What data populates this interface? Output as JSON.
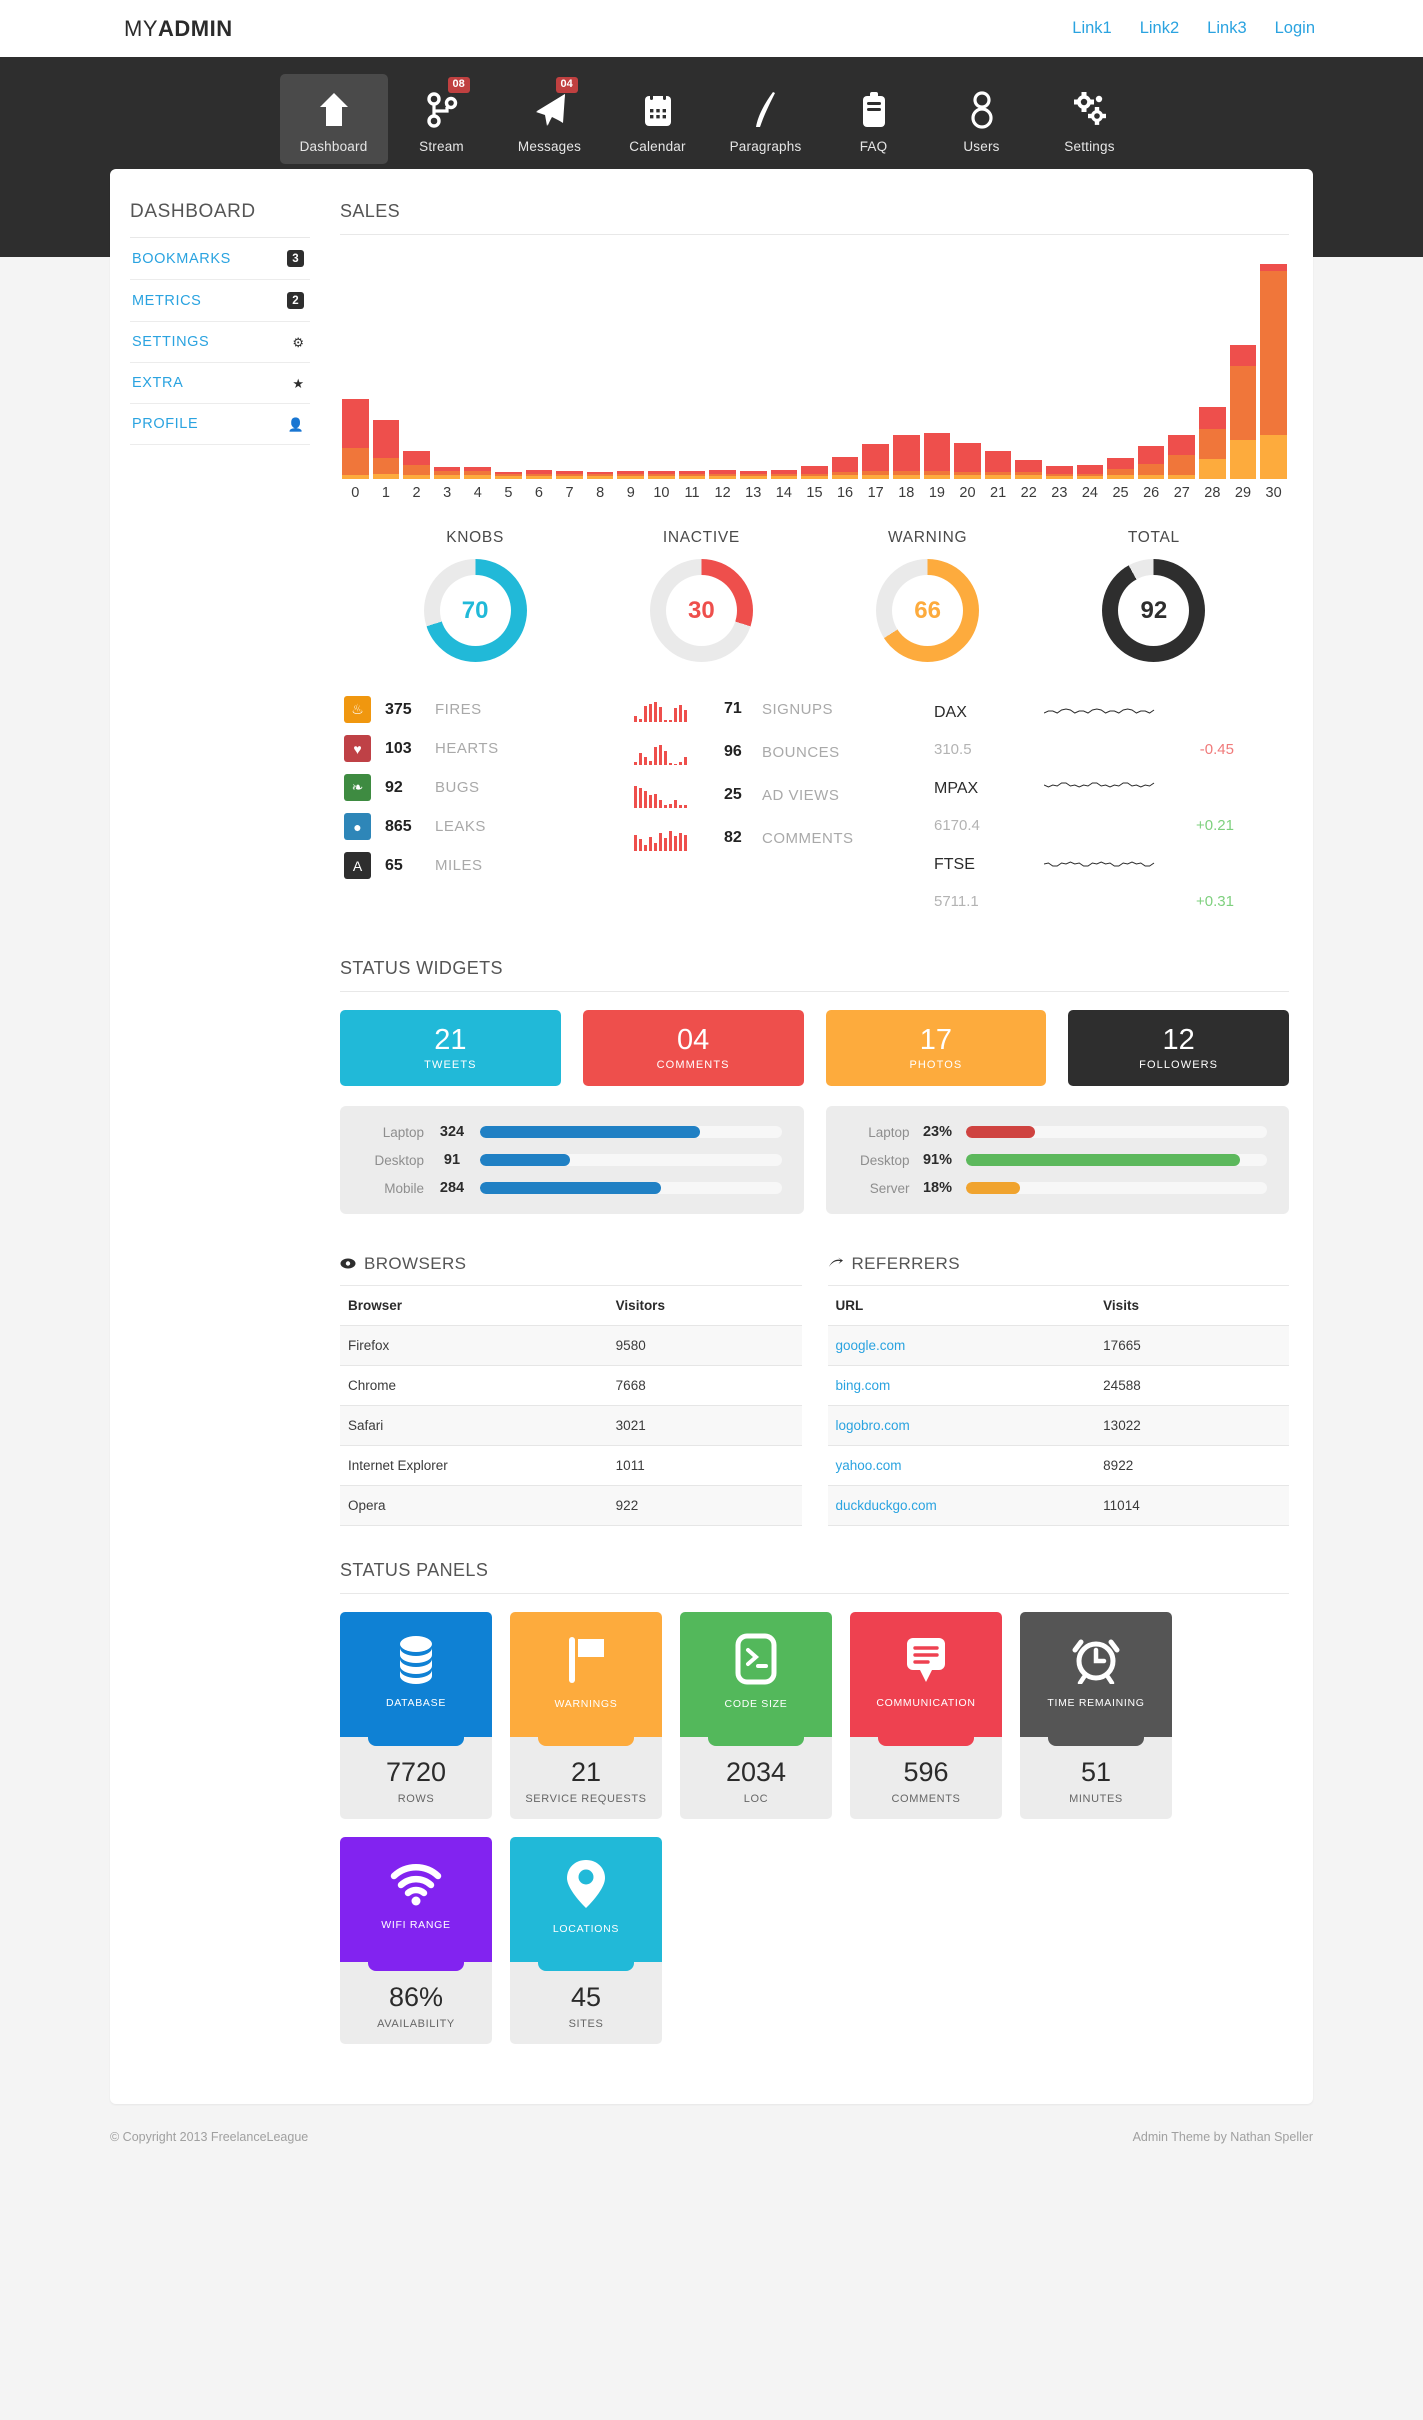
{
  "header": {
    "brand_prefix": "MY",
    "brand_suffix": "ADMIN",
    "links": [
      {
        "label": "Link1"
      },
      {
        "label": "Link2"
      },
      {
        "label": "Link3"
      },
      {
        "label": "Login"
      }
    ]
  },
  "nav": {
    "items": [
      {
        "label": "Dashboard",
        "icon": "home-icon",
        "badge": "",
        "active": true
      },
      {
        "label": "Stream",
        "icon": "stream-icon",
        "badge": "08",
        "active": false
      },
      {
        "label": "Messages",
        "icon": "paper-plane-icon",
        "badge": "04",
        "active": false
      },
      {
        "label": "Calendar",
        "icon": "calendar-icon",
        "badge": "",
        "active": false
      },
      {
        "label": "Paragraphs",
        "icon": "quill-pen-icon",
        "badge": "",
        "active": false
      },
      {
        "label": "FAQ",
        "icon": "clipboard-icon",
        "badge": "",
        "active": false
      },
      {
        "label": "Users",
        "icon": "users-icon",
        "badge": "",
        "active": false
      },
      {
        "label": "Settings",
        "icon": "gears-icon",
        "badge": "",
        "active": false
      }
    ]
  },
  "sidebar": {
    "title": "DASHBOARD",
    "items": [
      {
        "label": "BOOKMARKS",
        "badge": "3",
        "icon": ""
      },
      {
        "label": "METRICS",
        "badge": "2",
        "icon": ""
      },
      {
        "label": "SETTINGS",
        "badge": "",
        "icon": "gear-icon"
      },
      {
        "label": "EXTRA",
        "badge": "",
        "icon": "star-icon"
      },
      {
        "label": "PROFILE",
        "badge": "",
        "icon": "user-icon"
      }
    ]
  },
  "sections": {
    "sales": "SALES",
    "status_widgets": "STATUS WIDGETS",
    "status_panels": "STATUS PANELS"
  },
  "chart_data": {
    "type": "bar",
    "title": "SALES",
    "xlabel": "",
    "ylabel": "",
    "grid": false,
    "legend": "none",
    "stacked": true,
    "categories": [
      "0",
      "1",
      "2",
      "3",
      "4",
      "5",
      "6",
      "7",
      "8",
      "9",
      "10",
      "11",
      "12",
      "13",
      "14",
      "15",
      "16",
      "17",
      "18",
      "19",
      "20",
      "21",
      "22",
      "23",
      "24",
      "25",
      "26",
      "27",
      "28",
      "29",
      "30"
    ],
    "series": [
      {
        "name": "amber",
        "color": "#fdab3d",
        "values": [
          5,
          6,
          5,
          4,
          4,
          3,
          3,
          3,
          3,
          3,
          3,
          3,
          3,
          3,
          3,
          3,
          4,
          5,
          5,
          5,
          4,
          4,
          4,
          3,
          3,
          4,
          5,
          5,
          22,
          44,
          50
        ]
      },
      {
        "name": "orange",
        "color": "#f0763a",
        "values": [
          30,
          18,
          11,
          5,
          5,
          3,
          3,
          3,
          3,
          3,
          3,
          3,
          3,
          3,
          3,
          3,
          4,
          4,
          4,
          4,
          4,
          4,
          4,
          3,
          3,
          7,
          12,
          22,
          34,
          83,
          184
        ]
      },
      {
        "name": "red",
        "color": "#ee4f4c",
        "values": [
          55,
          42,
          16,
          4,
          5,
          2,
          4,
          3,
          2,
          3,
          3,
          3,
          4,
          3,
          4,
          9,
          17,
          30,
          41,
          43,
          33,
          23,
          13,
          9,
          10,
          13,
          20,
          23,
          25,
          24,
          8
        ]
      }
    ],
    "ylim": [
      0,
      245
    ]
  },
  "donuts": [
    {
      "label": "KNOBS",
      "value": "70",
      "percent": 70,
      "color": "#21b9d8",
      "track": "#eaeaea"
    },
    {
      "label": "INACTIVE",
      "value": "30",
      "percent": 30,
      "color": "#ee4f4c",
      "track": "#eaeaea"
    },
    {
      "label": "WARNING",
      "value": "66",
      "percent": 66,
      "color": "#fdab3d",
      "track": "#eaeaea"
    },
    {
      "label": "TOTAL",
      "value": "92",
      "percent": 92,
      "color": "#2e2e2e",
      "track": "#eaeaea"
    }
  ],
  "icon_stats": [
    {
      "icon": "fire-icon",
      "glyph": "♨",
      "color": "#f0970f",
      "value": "375",
      "label": "FIRES"
    },
    {
      "icon": "heart-icon",
      "glyph": "♥",
      "color": "#bf4146",
      "value": "103",
      "label": "HEARTS"
    },
    {
      "icon": "leaf-icon",
      "glyph": "❧",
      "color": "#3e8b41",
      "value": "92",
      "label": "BUGS"
    },
    {
      "icon": "droplet-icon",
      "glyph": "●",
      "color": "#2e86b8",
      "value": "865",
      "label": "LEAKS"
    },
    {
      "icon": "road-icon",
      "glyph": "A",
      "color": "#2e2e2e",
      "value": "65",
      "label": "MILES"
    }
  ],
  "spark_stats": [
    {
      "label": "SIGNUPS",
      "value": "71",
      "bars": [
        6,
        3,
        16,
        18,
        20,
        15,
        2,
        2,
        14,
        17,
        12
      ],
      "color": "#ee4f4c"
    },
    {
      "label": "BOUNCES",
      "value": "96",
      "bars": [
        3,
        12,
        8,
        4,
        18,
        20,
        14,
        2,
        1,
        3,
        8
      ],
      "color": "#ee4f4c"
    },
    {
      "label": "AD VIEWS",
      "value": "25",
      "bars": [
        22,
        20,
        17,
        13,
        14,
        8,
        3,
        4,
        8,
        3,
        3
      ],
      "color": "#ee4f4c"
    },
    {
      "label": "COMMENTS",
      "value": "82",
      "bars": [
        16,
        12,
        6,
        14,
        8,
        18,
        13,
        20,
        15,
        18,
        16
      ],
      "color": "#ee4f4c"
    }
  ],
  "stocks": [
    {
      "name": "DAX",
      "value": "310.5",
      "delta": "-0.45",
      "direction": "down"
    },
    {
      "name": "MPAX",
      "value": "6170.4",
      "delta": "+0.21",
      "direction": "up"
    },
    {
      "name": "FTSE",
      "value": "5711.1",
      "delta": "+0.31",
      "direction": "up"
    }
  ],
  "status_widgets": [
    {
      "value": "21",
      "label": "TWEETS",
      "color": "#21b9d8"
    },
    {
      "value": "04",
      "label": "COMMENTS",
      "color": "#ee4f4c"
    },
    {
      "value": "17",
      "label": "PHOTOS",
      "color": "#fdab3d"
    },
    {
      "value": "12",
      "label": "FOLLOWERS",
      "color": "#2e2e2e"
    }
  ],
  "progress_left": [
    {
      "name": "Laptop",
      "value": "324",
      "percent": 73,
      "color": "#2080c4"
    },
    {
      "name": "Desktop",
      "value": "91",
      "percent": 30,
      "color": "#2080c4"
    },
    {
      "name": "Mobile",
      "value": "284",
      "percent": 60,
      "color": "#2080c4"
    }
  ],
  "progress_right": [
    {
      "name": "Laptop",
      "value": "23%",
      "percent": 23,
      "color": "#cf4340"
    },
    {
      "name": "Desktop",
      "value": "91%",
      "percent": 91,
      "color": "#5cb85c"
    },
    {
      "name": "Server",
      "value": "18%",
      "percent": 18,
      "color": "#f0a32e"
    }
  ],
  "browsers": {
    "title": "BROWSERS",
    "icon": "eye-icon",
    "columns": [
      "Browser",
      "Visitors"
    ],
    "rows": [
      [
        "Firefox",
        "9580"
      ],
      [
        "Chrome",
        "7668"
      ],
      [
        "Safari",
        "3021"
      ],
      [
        "Internet Explorer",
        "1011"
      ],
      [
        "Opera",
        "922"
      ]
    ]
  },
  "referrers": {
    "title": "REFERRERS",
    "icon": "arrow-icon",
    "columns": [
      "URL",
      "Visits"
    ],
    "rows": [
      [
        "google.com",
        "17665"
      ],
      [
        "bing.com",
        "24588"
      ],
      [
        "logobro.com",
        "13022"
      ],
      [
        "yahoo.com",
        "8922"
      ],
      [
        "duckduckgo.com",
        "11014"
      ]
    ]
  },
  "status_panels": [
    {
      "label": "DATABASE",
      "icon": "database-icon",
      "color": "#0f81d4",
      "value": "7720",
      "sub": "ROWS"
    },
    {
      "label": "WARNINGS",
      "icon": "flag-icon",
      "color": "#fdab3d",
      "value": "21",
      "sub": "SERVICE REQUESTS"
    },
    {
      "label": "CODE SIZE",
      "icon": "terminal-icon",
      "color": "#53b85b",
      "value": "2034",
      "sub": "LOC"
    },
    {
      "label": "COMMUNICATION",
      "icon": "comment-icon",
      "color": "#ee4150",
      "value": "596",
      "sub": "COMMENTS"
    },
    {
      "label": "TIME REMAINING",
      "icon": "alarm-clock-icon",
      "color": "#555555",
      "value": "51",
      "sub": "MINUTES"
    },
    {
      "label": "WIFI RANGE",
      "icon": "wifi-icon",
      "color": "#8223f0",
      "value": "86%",
      "sub": "AVAILABILITY"
    },
    {
      "label": "LOCATIONS",
      "icon": "map-pin-icon",
      "color": "#21b9d8",
      "value": "45",
      "sub": "SITES"
    }
  ],
  "footer": {
    "left": "© Copyright 2013 FreelanceLeague",
    "right": "Admin Theme by Nathan Speller"
  }
}
